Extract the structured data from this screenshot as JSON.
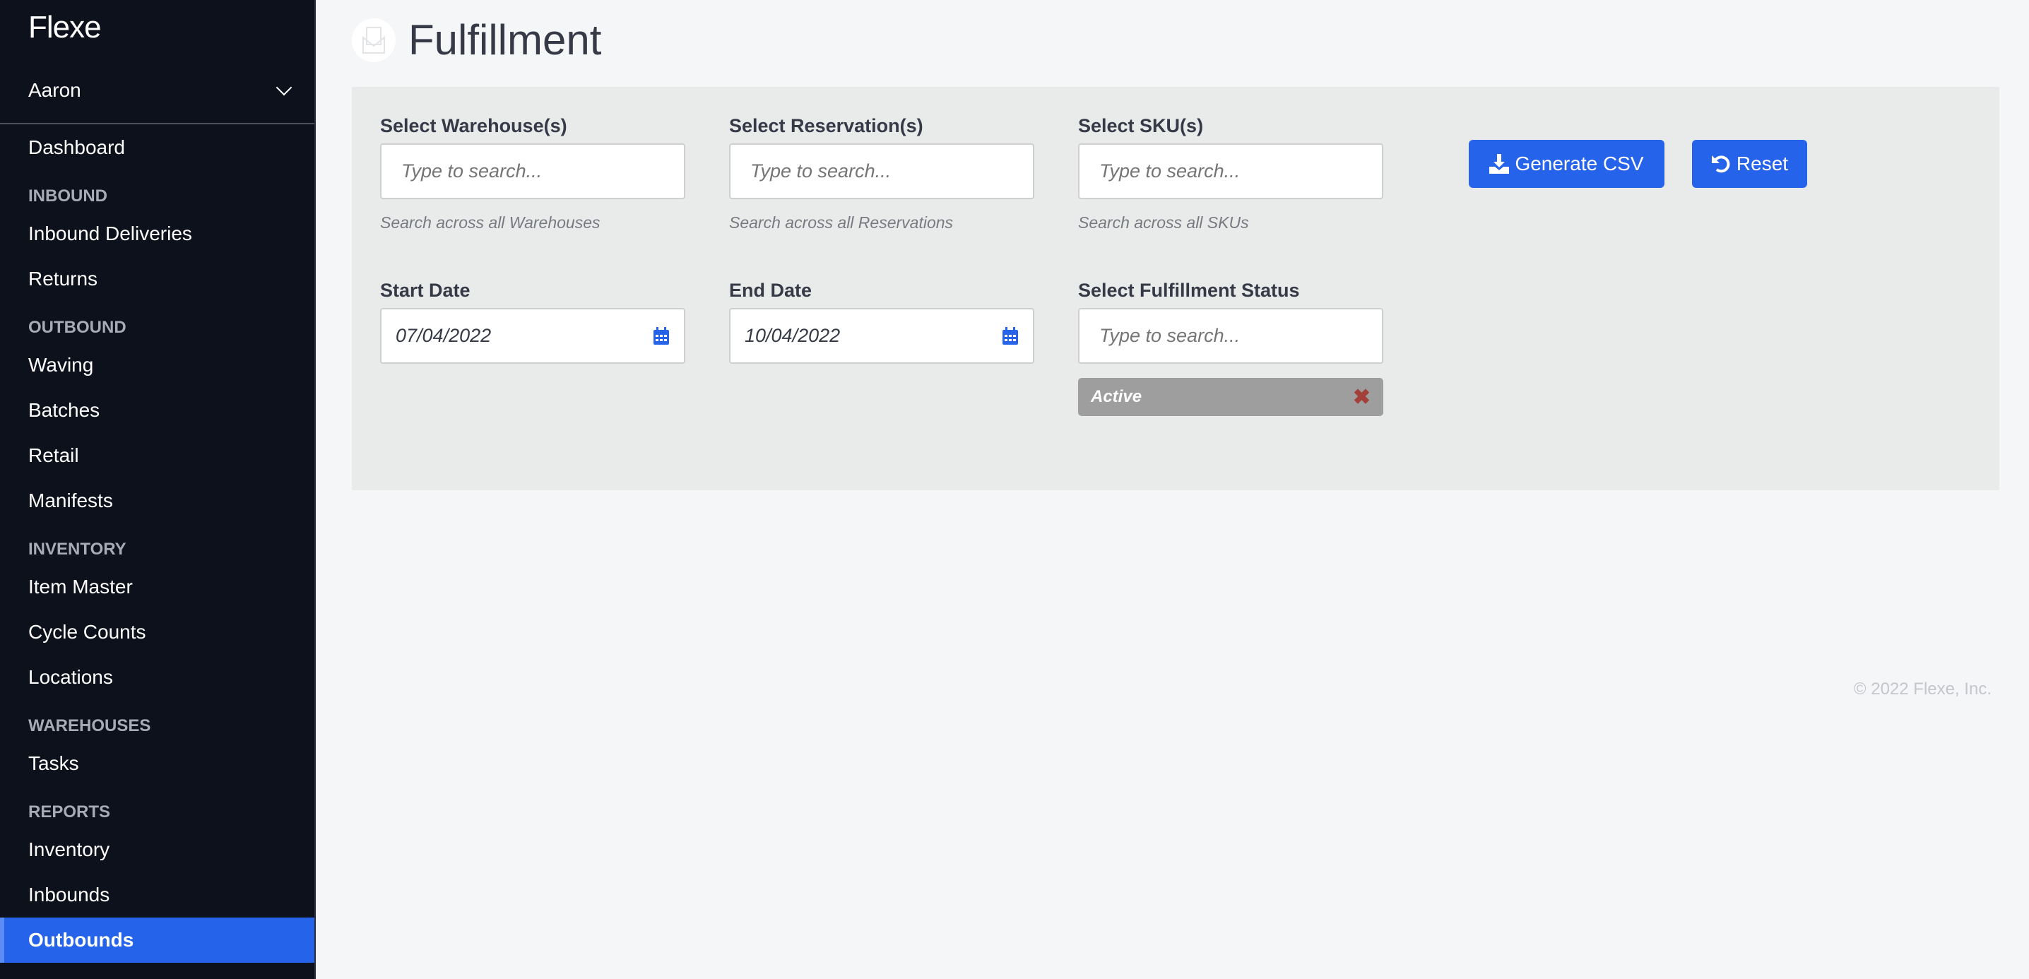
{
  "sidebar": {
    "logo": "Flexe",
    "user": "Aaron",
    "nav": [
      {
        "type": "item",
        "label": "Dashboard"
      },
      {
        "type": "header",
        "label": "INBOUND"
      },
      {
        "type": "item",
        "label": "Inbound Deliveries"
      },
      {
        "type": "item",
        "label": "Returns"
      },
      {
        "type": "header",
        "label": "OUTBOUND"
      },
      {
        "type": "item",
        "label": "Waving"
      },
      {
        "type": "item",
        "label": "Batches"
      },
      {
        "type": "item",
        "label": "Retail"
      },
      {
        "type": "item",
        "label": "Manifests"
      },
      {
        "type": "header",
        "label": "INVENTORY"
      },
      {
        "type": "item",
        "label": "Item Master"
      },
      {
        "type": "item",
        "label": "Cycle Counts"
      },
      {
        "type": "item",
        "label": "Locations"
      },
      {
        "type": "header",
        "label": "WAREHOUSES"
      },
      {
        "type": "item",
        "label": "Tasks"
      },
      {
        "type": "header",
        "label": "REPORTS"
      },
      {
        "type": "item",
        "label": "Inventory"
      },
      {
        "type": "item",
        "label": "Inbounds"
      },
      {
        "type": "item",
        "label": "Outbounds",
        "active": true
      }
    ]
  },
  "page": {
    "title": "Fulfillment"
  },
  "filters": {
    "warehouse": {
      "label": "Select Warehouse(s)",
      "placeholder": "Type to search...",
      "help": "Search across all Warehouses"
    },
    "reservation": {
      "label": "Select Reservation(s)",
      "placeholder": "Type to search...",
      "help": "Search across all Reservations"
    },
    "sku": {
      "label": "Select SKU(s)",
      "placeholder": "Type to search...",
      "help": "Search across all SKUs"
    },
    "start_date": {
      "label": "Start Date",
      "value": "07/04/2022"
    },
    "end_date": {
      "label": "End Date",
      "value": "10/04/2022"
    },
    "status": {
      "label": "Select Fulfillment Status",
      "placeholder": "Type to search...",
      "selected": [
        "Active"
      ]
    }
  },
  "actions": {
    "generate_csv": "Generate CSV",
    "reset": "Reset"
  },
  "footer": "© 2022 Flexe, Inc.",
  "colors": {
    "accent": "#2563eb",
    "sidebar": "#0d111b",
    "panel": "#e9eaea"
  }
}
